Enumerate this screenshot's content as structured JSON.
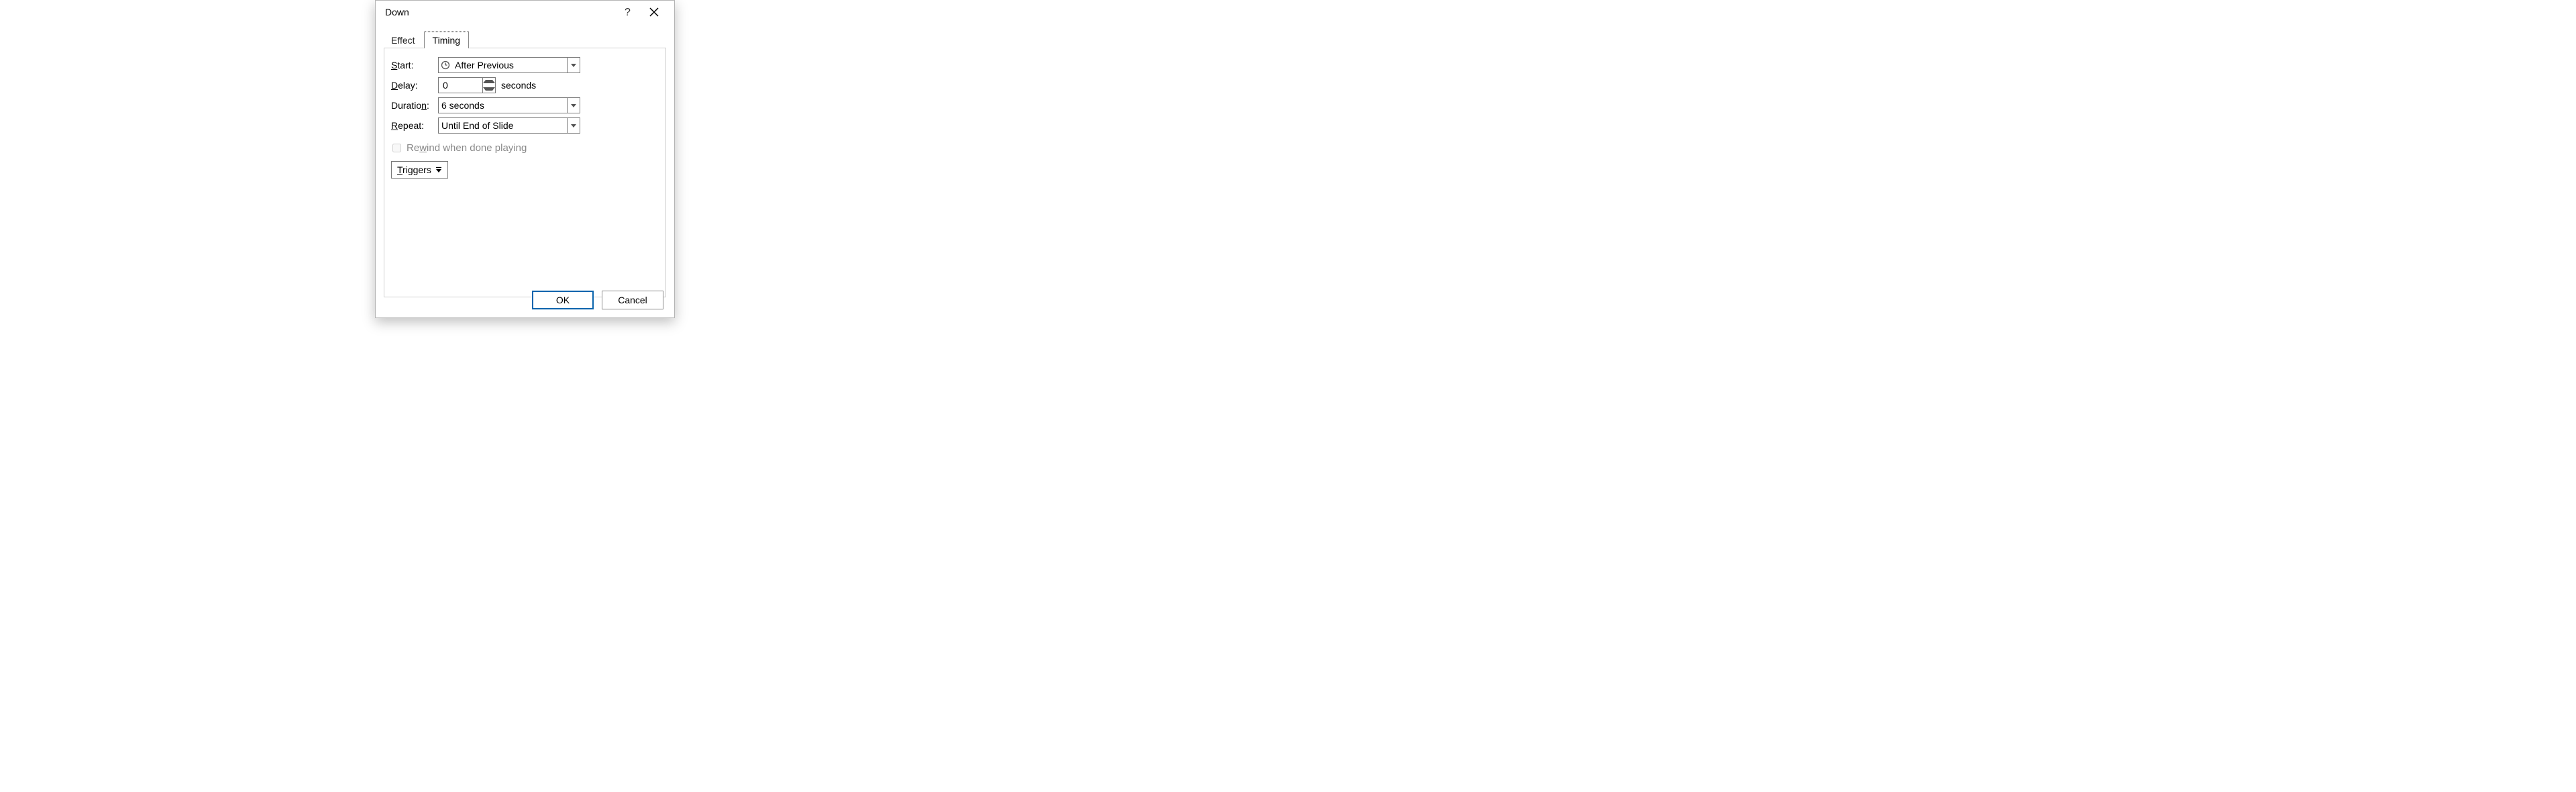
{
  "title": "Down",
  "tabs": {
    "effect": "Effect",
    "timing": "Timing",
    "active": "Timing"
  },
  "labels": {
    "start": "Start:",
    "delay": "Delay:",
    "duration": "Duration:",
    "repeat": "Repeat:",
    "seconds": "seconds"
  },
  "underlines": {
    "start": "S",
    "delay": "D",
    "duration": "n",
    "repeat": "R",
    "rewind": "w",
    "triggers": "T"
  },
  "values": {
    "start": "After Previous",
    "delay": "0",
    "duration": "6 seconds",
    "repeat": "Until End of Slide"
  },
  "rewind": {
    "label": "Rewind when done playing",
    "checked": false,
    "enabled": false
  },
  "triggers": "Triggers",
  "buttons": {
    "ok": "OK",
    "cancel": "Cancel"
  }
}
